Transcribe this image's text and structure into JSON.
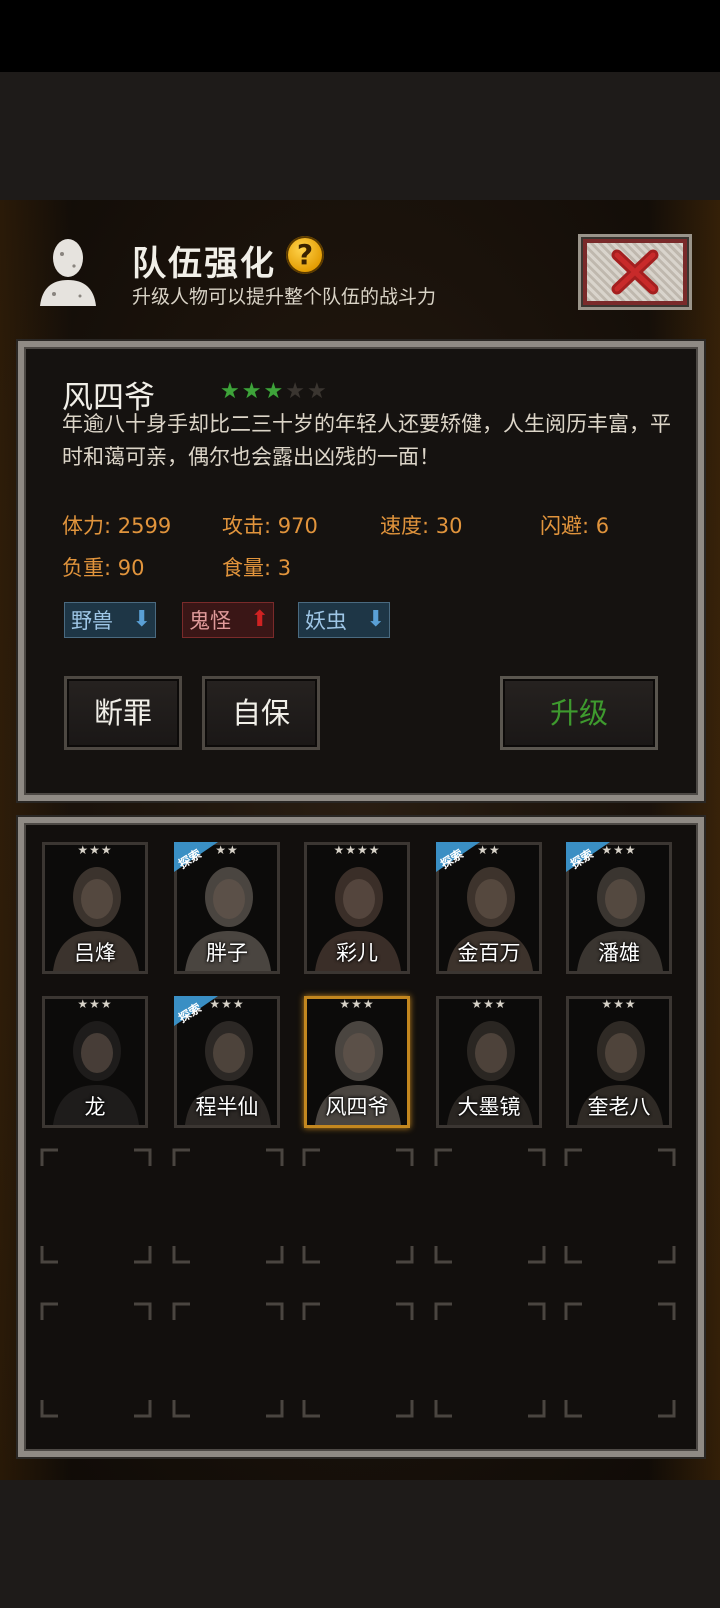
{
  "header": {
    "title": "队伍强化",
    "subtitle": "升级人物可以提升整个队伍的战斗力",
    "help_symbol": "?",
    "close_icon": "close-x-icon"
  },
  "character": {
    "name": "风四爷",
    "stars_filled": 3,
    "stars_total": 5,
    "description": "年逾八十身手却比二三十岁的年轻人还要矫健，人生阅历丰富，平时和蔼可亲，偶尔也会露出凶残的一面！",
    "stats": {
      "hp": "体力: 2599",
      "attack": "攻击: 970",
      "speed": "速度: 30",
      "dodge": "闪避: 6",
      "load": "负重: 90",
      "food": "食量: 3"
    },
    "tags": [
      {
        "label": "野兽",
        "arrow": "down"
      },
      {
        "label": "鬼怪",
        "arrow": "up"
      },
      {
        "label": "妖虫",
        "arrow": "down"
      }
    ]
  },
  "actions": {
    "skill1": "断罪",
    "skill2": "自保",
    "upgrade": "升级"
  },
  "roster": [
    {
      "name": "吕烽",
      "stars": "★★★",
      "explore": false
    },
    {
      "name": "胖子",
      "stars": "★★",
      "explore": true
    },
    {
      "name": "彩儿",
      "stars": "★★★★",
      "explore": false
    },
    {
      "name": "金百万",
      "stars": "★★",
      "explore": true
    },
    {
      "name": "潘雄",
      "stars": "★★★",
      "explore": true
    },
    {
      "name": "龙",
      "stars": "★★★",
      "explore": false
    },
    {
      "name": "程半仙",
      "stars": "★★★",
      "explore": true
    },
    {
      "name": "风四爷",
      "stars": "★★★",
      "explore": false,
      "selected": true
    },
    {
      "name": "大墨镜",
      "stars": "★★★",
      "explore": false
    },
    {
      "name": "奎老八",
      "stars": "★★★",
      "explore": false
    }
  ],
  "explore_label": "探索",
  "colors": {
    "stat_text": "#e1943c",
    "upgrade_text": "#3e9a2e",
    "selected_border": "#c3871f",
    "explore_badge": "#3a8fc4"
  }
}
